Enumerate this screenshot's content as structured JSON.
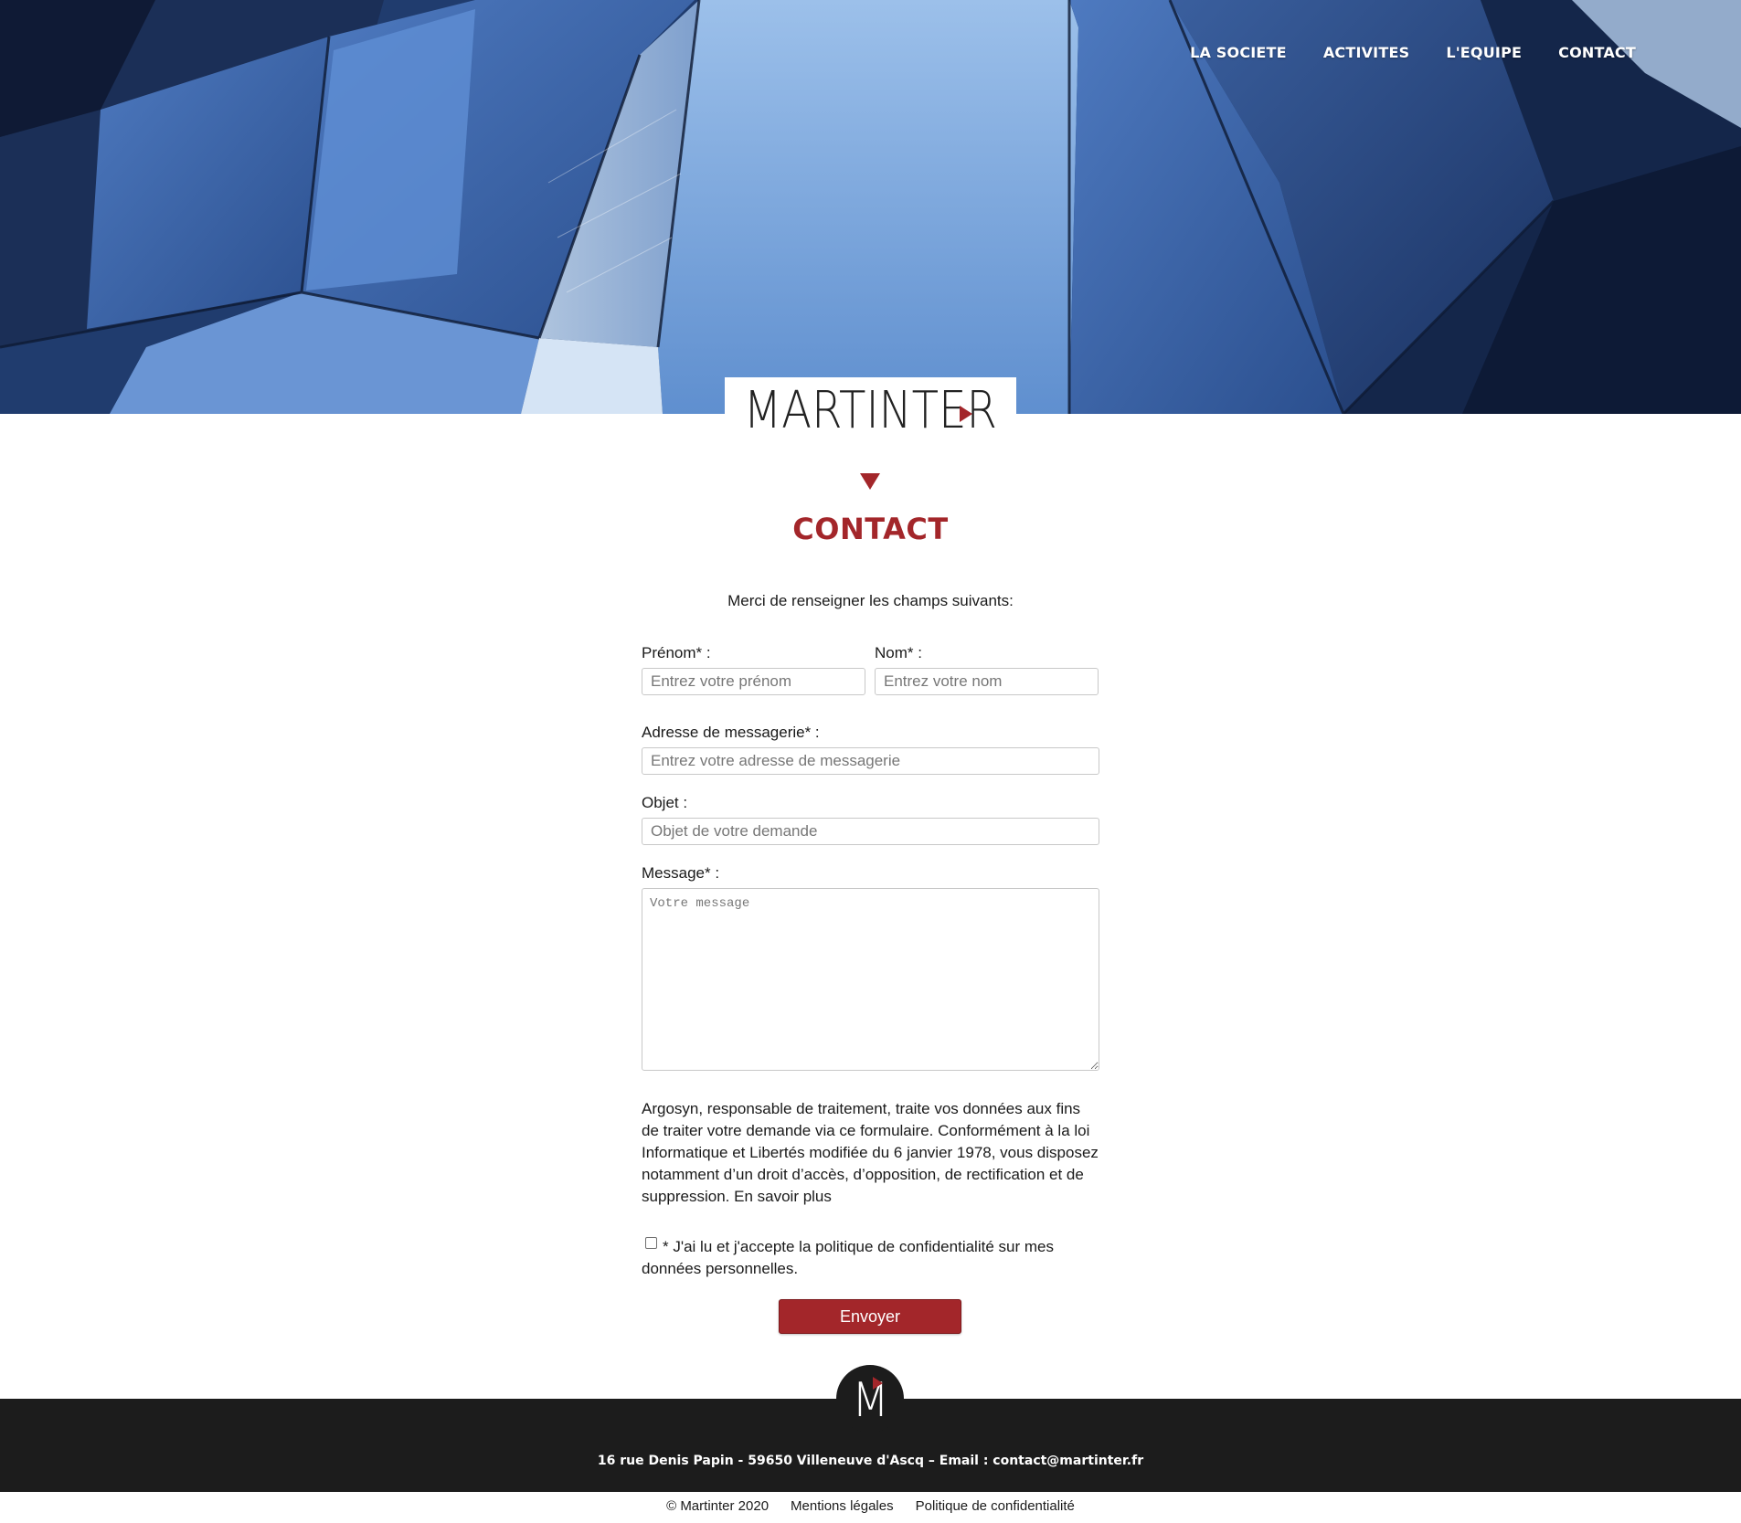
{
  "brand": {
    "logo_text": "MARTINTER",
    "footer_logo_letter": "M",
    "accent_color": "#a3262a"
  },
  "nav": {
    "items": [
      {
        "label": "LA SOCIETE"
      },
      {
        "label": "ACTIVITES"
      },
      {
        "label": "L'EQUIPE"
      },
      {
        "label": "CONTACT"
      }
    ]
  },
  "page": {
    "title": "CONTACT",
    "intro": "Merci de renseigner les champs suivants:"
  },
  "form": {
    "firstname": {
      "label": "Prénom* :",
      "placeholder": "Entrez votre prénom",
      "value": ""
    },
    "lastname": {
      "label": "Nom* :",
      "placeholder": "Entrez votre nom",
      "value": ""
    },
    "email": {
      "label": "Adresse de messagerie* :",
      "placeholder": "Entrez votre adresse de messagerie",
      "value": ""
    },
    "subject": {
      "label": "Objet :",
      "placeholder": "Objet de votre demande",
      "value": ""
    },
    "message": {
      "label": "Message* :",
      "placeholder": "Votre message",
      "value": ""
    },
    "privacy_text": "Argosyn, responsable de traitement, traite vos données aux fins de traiter votre demande via ce formulaire. Conformément à la loi Informatique et Libertés modifiée du 6 janvier 1978, vous disposez notamment d’un droit d’accès, d’opposition, de rectification et de suppression. En savoir plus",
    "consent_label": "* J'ai lu et j'accepte la politique de confidentialité sur mes données personnelles.",
    "consent_checked": false,
    "submit_label": "Envoyer"
  },
  "footer": {
    "address": "16 rue Denis Papin - 59650 Villeneuve d'Ascq – Email : contact@martinter.fr",
    "copyright": "© Martinter 2020",
    "legal_link": "Mentions légales",
    "privacy_link": "Politique de confidentialité"
  }
}
